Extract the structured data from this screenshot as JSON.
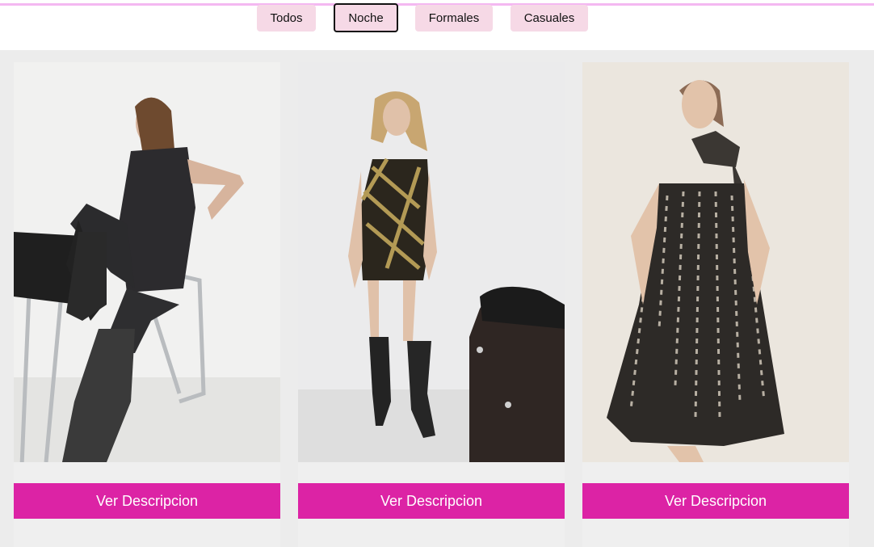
{
  "filters": {
    "items": [
      {
        "label": "Todos"
      },
      {
        "label": "Noche"
      },
      {
        "label": "Formales"
      },
      {
        "label": "Casuales"
      }
    ],
    "active": "Noche"
  },
  "products": [
    {
      "button_label": "Ver Descripcion"
    },
    {
      "button_label": "Ver Descripcion"
    },
    {
      "button_label": "Ver Descripcion"
    }
  ],
  "colors": {
    "accent": "#dc23a5",
    "filter_bg": "#f6d9e6",
    "top_line": "#f4b8f1",
    "page_bg": "#ececec"
  }
}
